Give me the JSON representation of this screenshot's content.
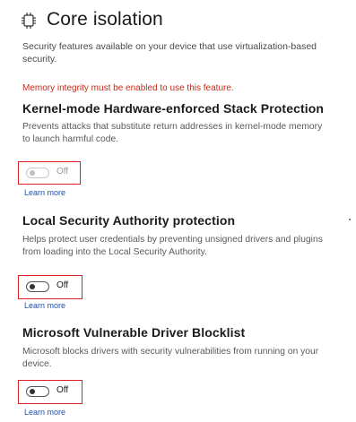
{
  "header": {
    "icon": "core-isolation-chip-icon",
    "title": "Core isolation",
    "description": "Security features available on your device that use virtualization-based security."
  },
  "warning": "Memory integrity must be enabled to use this feature.",
  "sections": [
    {
      "title": "Kernel-mode Hardware-enforced Stack Protection",
      "description": "Prevents attacks that substitute return addresses in kernel-mode memory to launch harmful code.",
      "toggle_state": "Off",
      "toggle_enabled": false,
      "learn_more": "Learn more"
    },
    {
      "title": "Local Security Authority protection",
      "description": "Helps protect user credentials by preventing unsigned drivers and plugins from loading into the Local Security Authority.",
      "toggle_state": "Off",
      "toggle_enabled": true,
      "learn_more": "Learn more"
    },
    {
      "title": "Microsoft Vulnerable Driver Blocklist",
      "description": "Microsoft blocks drivers with security vulnerabilities from running on your device.",
      "toggle_state": "Off",
      "toggle_enabled": true,
      "learn_more": "Learn more"
    }
  ],
  "colors": {
    "warning": "#c42b1c",
    "link": "#1f4fa8",
    "highlight_border": "#e02020"
  }
}
